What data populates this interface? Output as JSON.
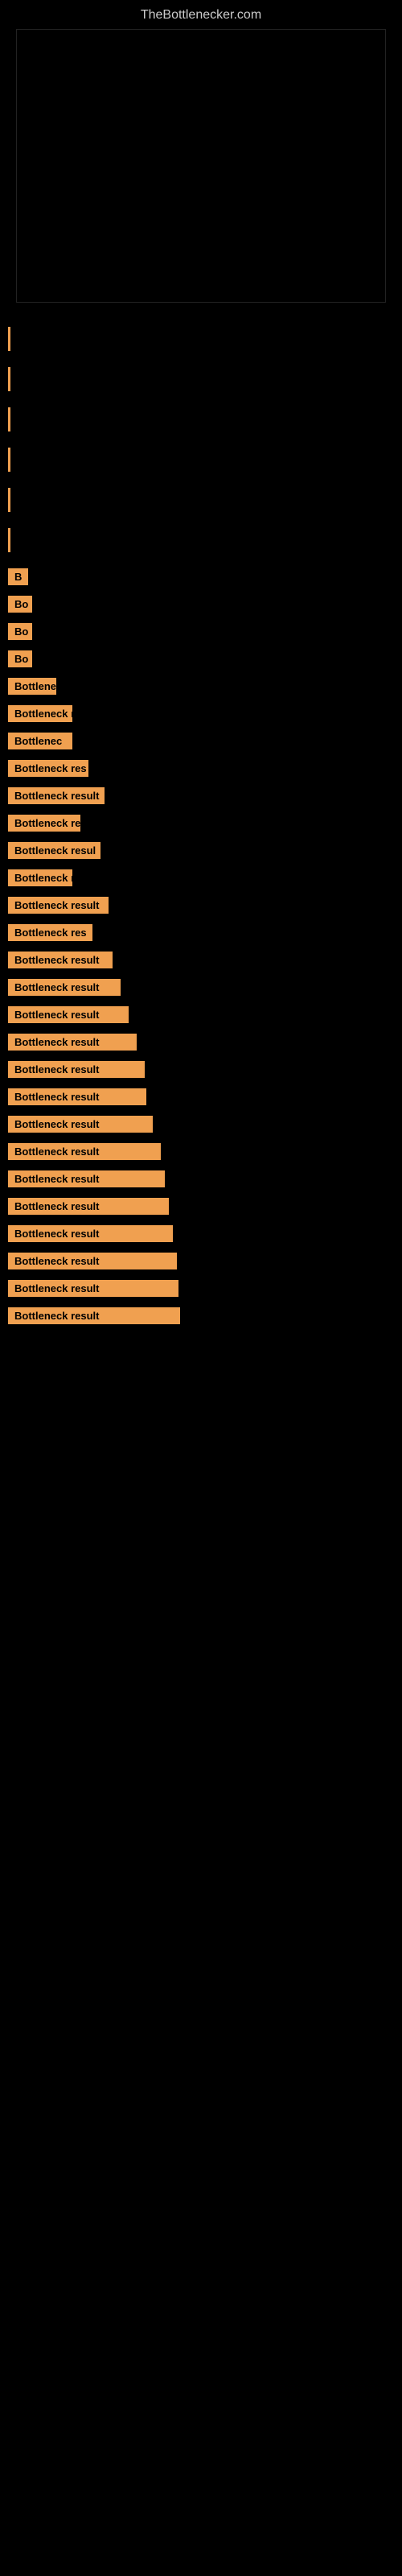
{
  "site": {
    "title": "TheBottlenecker.com"
  },
  "items": [
    {
      "id": 1,
      "label": "",
      "width_class": "w-20",
      "gap": "large"
    },
    {
      "id": 2,
      "label": "",
      "width_class": "w-20",
      "gap": "large"
    },
    {
      "id": 3,
      "label": "",
      "width_class": "w-20",
      "gap": "large"
    },
    {
      "id": 4,
      "label": "",
      "width_class": "w-20",
      "gap": "large"
    },
    {
      "id": 5,
      "label": "",
      "width_class": "w-20",
      "gap": "large"
    },
    {
      "id": 6,
      "label": "",
      "width_class": "w-20",
      "gap": "large"
    },
    {
      "id": 7,
      "label": "B",
      "width_class": "w-25",
      "gap": "medium"
    },
    {
      "id": 8,
      "label": "Bo",
      "width_class": "w-30",
      "gap": "medium"
    },
    {
      "id": 9,
      "label": "Bo",
      "width_class": "w-30",
      "gap": "medium"
    },
    {
      "id": 10,
      "label": "Bo",
      "width_class": "w-30",
      "gap": "medium"
    },
    {
      "id": 11,
      "label": "Bottlene",
      "width_class": "w-60",
      "gap": "medium"
    },
    {
      "id": 12,
      "label": "Bottleneck r",
      "width_class": "w-90",
      "gap": "medium"
    },
    {
      "id": 13,
      "label": "Bottlenec",
      "width_class": "w-80",
      "gap": "medium"
    },
    {
      "id": 14,
      "label": "Bottleneck res",
      "width_class": "w-100",
      "gap": "medium"
    },
    {
      "id": 15,
      "label": "Bottleneck result",
      "width_class": "w-120",
      "gap": "medium"
    },
    {
      "id": 16,
      "label": "Bottleneck re",
      "width_class": "w-95",
      "gap": "medium"
    },
    {
      "id": 17,
      "label": "Bottleneck resul",
      "width_class": "w-115",
      "gap": "medium"
    },
    {
      "id": 18,
      "label": "Bottleneck r",
      "width_class": "w-90",
      "gap": "medium"
    },
    {
      "id": 19,
      "label": "Bottleneck result",
      "width_class": "w-125",
      "gap": "medium"
    },
    {
      "id": 20,
      "label": "Bottleneck res",
      "width_class": "w-105",
      "gap": "medium"
    },
    {
      "id": 21,
      "label": "Bottleneck result",
      "width_class": "w-130",
      "gap": "medium"
    },
    {
      "id": 22,
      "label": "Bottleneck result",
      "width_class": "w-140",
      "gap": "medium"
    },
    {
      "id": 23,
      "label": "Bottleneck result",
      "width_class": "w-150",
      "gap": "medium"
    },
    {
      "id": 24,
      "label": "Bottleneck result",
      "width_class": "w-160",
      "gap": "medium"
    },
    {
      "id": 25,
      "label": "Bottleneck result",
      "width_class": "w-170",
      "gap": "medium"
    },
    {
      "id": 26,
      "label": "Bottleneck result",
      "width_class": "w-172",
      "gap": "medium"
    },
    {
      "id": 27,
      "label": "Bottleneck result",
      "width_class": "w-180",
      "gap": "medium"
    },
    {
      "id": 28,
      "label": "Bottleneck result",
      "width_class": "w-190",
      "gap": "medium"
    },
    {
      "id": 29,
      "label": "Bottleneck result",
      "width_class": "w-195",
      "gap": "medium"
    },
    {
      "id": 30,
      "label": "Bottleneck result",
      "width_class": "w-200",
      "gap": "medium"
    },
    {
      "id": 31,
      "label": "Bottleneck result",
      "width_class": "w-205",
      "gap": "medium"
    },
    {
      "id": 32,
      "label": "Bottleneck result",
      "width_class": "w-210",
      "gap": "medium"
    },
    {
      "id": 33,
      "label": "Bottleneck result",
      "width_class": "w-212",
      "gap": "medium"
    },
    {
      "id": 34,
      "label": "Bottleneck result",
      "width_class": "w-214",
      "gap": "medium"
    }
  ]
}
